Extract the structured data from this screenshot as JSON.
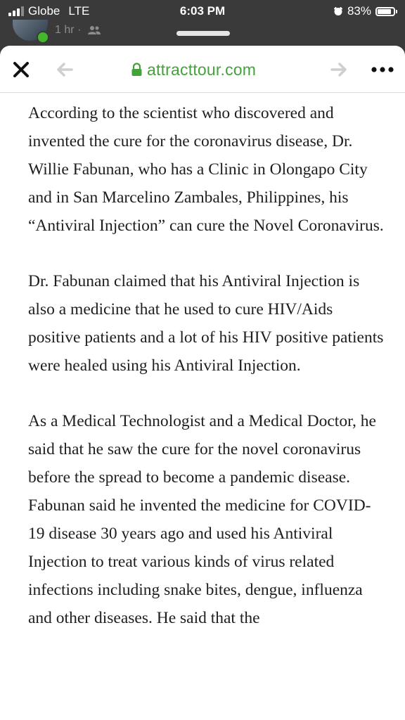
{
  "status_bar": {
    "carrier": "Globe",
    "network": "LTE",
    "time": "6:03 PM",
    "battery": "83%"
  },
  "background_post": {
    "meta": "1 hr ·"
  },
  "browser": {
    "url": "attracttour.com",
    "accent_color": "#43a23a"
  },
  "article": {
    "paragraphs": [
      "According to the scientist who discovered and invented the cure for the coronavirus disease, Dr. Willie Fabunan, who has a Clinic in Olongapo City and in San Marcelino Zambales, Philippines, his “Antiviral Injection” can cure the Novel Coronavirus.",
      "Dr. Fabunan claimed that his Antiviral Injection is also a medicine that he used to cure HIV/Aids positive patients and a lot of his HIV positive patients were healed using his Antiviral Injection.",
      "As a Medical Technologist and a Medical Doctor, he said that he saw the cure for the novel coronavirus before the spread to become a pandemic disease. Fabunan said he invented the medicine for COVID-19 disease 30 years ago and used his Antiviral Injection to treat various kinds of virus related infections including snake bites, dengue, influenza and other diseases. He said that the"
    ]
  }
}
